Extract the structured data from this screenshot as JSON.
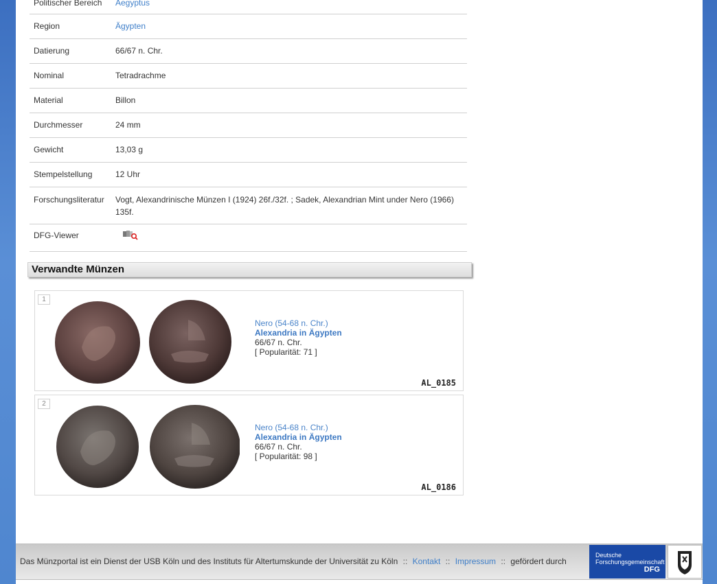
{
  "details": {
    "rows": [
      {
        "label": "Politischer Bereich",
        "value": "Aegyptus",
        "link": true
      },
      {
        "label": "Region",
        "value": "Ägypten",
        "link": true
      },
      {
        "label": "Datierung",
        "value": "66/67 n. Chr."
      },
      {
        "label": "Nominal",
        "value": "Tetradrachme"
      },
      {
        "label": "Material",
        "value": "Billon"
      },
      {
        "label": "Durchmesser",
        "value": "24 mm"
      },
      {
        "label": "Gewicht",
        "value": "13,03 g"
      },
      {
        "label": "Stempelstellung",
        "value": "12 Uhr"
      },
      {
        "label": "Forschungsliteratur",
        "value": "Vogt, Alexandrinische Münzen I (1924) 26f./32f. ; Sadek, Alexandrian Mint under Nero (1966) 135f."
      },
      {
        "label": "DFG-Viewer",
        "value": "",
        "icon": "dfg-viewer-icon"
      }
    ]
  },
  "related": {
    "title": "Verwandte Münzen",
    "coins": [
      {
        "num": "1",
        "ruler": "Nero (54-68 n. Chr.)",
        "mint": "Alexandria in Ägypten",
        "date": "66/67 n. Chr.",
        "popularity": "[ Popularität: 71 ]",
        "code": "AL_0185"
      },
      {
        "num": "2",
        "ruler": "Nero (54-68 n. Chr.)",
        "mint": "Alexandria in Ägypten",
        "date": "66/67 n. Chr.",
        "popularity": "[ Popularität: 98 ]",
        "code": "AL_0186"
      }
    ]
  },
  "footer": {
    "text": "Das Münzportal ist ein Dienst der USB Köln und des Instituts für Altertumskunde der Universität zu Köln",
    "sep": "::",
    "contact": "Kontakt",
    "imprint": "Impressum",
    "funded": "gefördert durch",
    "dfg_line1": "Deutsche",
    "dfg_line2": "Forschungsgemeinschaft",
    "dfg_short": "DFG"
  }
}
